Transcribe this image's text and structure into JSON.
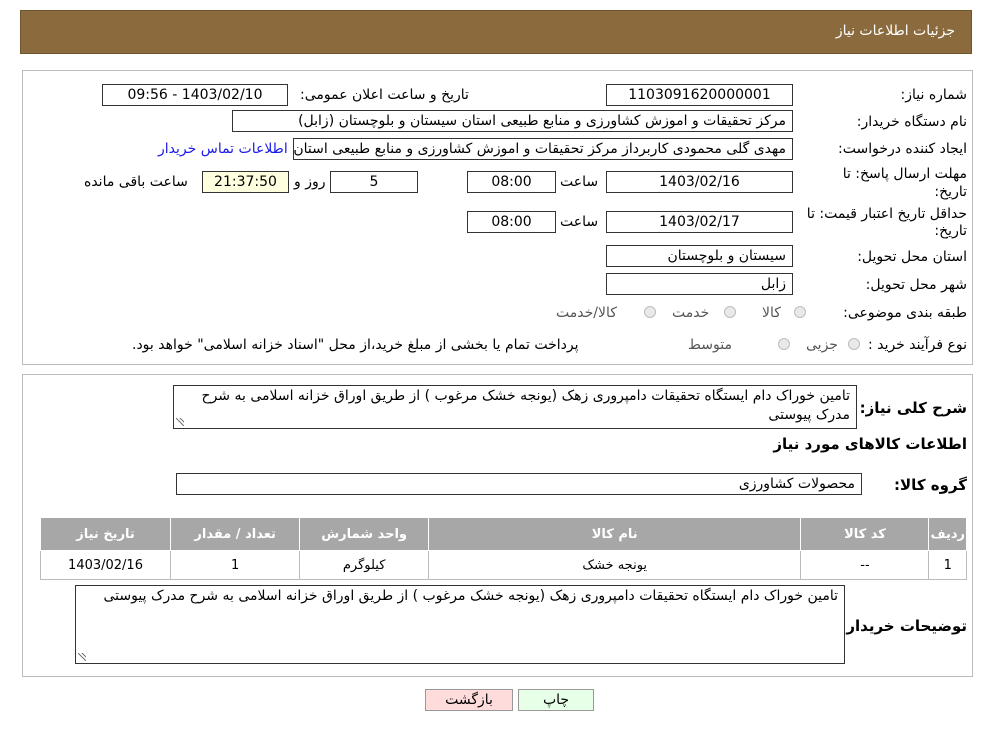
{
  "header": {
    "title": "جزئیات اطلاعات نیاز"
  },
  "form": {
    "need_number_label": "شماره نیاز:",
    "need_number": "1103091620000001",
    "announce_label": "تاریخ و ساعت اعلان عمومی:",
    "announce_value": "1403/02/10 - 09:56",
    "buyer_label": "نام دستگاه خریدار:",
    "buyer_value": "مرکز تحقیقات و اموزش کشاورزی و منابع طبیعی استان سیستان و بلوچستان (زابل)",
    "creator_label": "ایجاد کننده درخواست:",
    "creator_value": "مهدی  گلی محمودی کاربرداز مرکز تحقیقات و اموزش کشاورزی و منابع طبیعی استان",
    "contact_link": "اطلاعات تماس خریدار",
    "reply_deadline_label_1": "مهلت ارسال پاسخ: تا",
    "reply_deadline_label_2": "تاریخ:",
    "reply_date": "1403/02/16",
    "time_label": "ساعت",
    "reply_time": "08:00",
    "days_value": "5",
    "days_label": "روز و",
    "remaining_time": "21:37:50",
    "remaining_label": "ساعت باقی مانده",
    "validity_label_1": "حداقل تاریخ اعتبار قیمت: تا",
    "validity_label_2": "تاریخ:",
    "validity_date": "1403/02/17",
    "validity_time": "08:00",
    "province_label": "استان محل تحویل:",
    "province_value": "سیستان و بلوچستان",
    "city_label": "شهر محل تحویل:",
    "city_value": "زابل",
    "category_label": "طبقه بندی موضوعی:",
    "category_options": [
      "کالا",
      "خدمت",
      "کالا/خدمت"
    ],
    "process_label": "نوع فرآیند خرید :",
    "process_options": [
      "جزیی",
      "متوسط"
    ],
    "process_note": "پرداخت تمام یا بخشی از مبلغ خرید،از محل \"اسناد خزانه اسلامی\" خواهد بود."
  },
  "details": {
    "summary_label": "شرح کلی نیاز:",
    "summary_value": "تامین خوراک دام ایستگاه تحقیقات دامپروری زهک (یونجه خشک مرغوب ) از طریق اوراق خزانه اسلامی به شرح مدرک پیوستی",
    "goods_section_title": "اطلاعات کالاهای مورد نیاز",
    "goods_group_label": "گروه کالا:",
    "goods_group_value": "محصولات کشاورزی",
    "table": {
      "headers": [
        "ردیف",
        "کد کالا",
        "نام کالا",
        "واحد شمارش",
        "تعداد / مقدار",
        "تاریخ نیاز"
      ],
      "rows": [
        [
          "1",
          "--",
          "یونجه خشک",
          "کیلوگرم",
          "1",
          "1403/02/16"
        ]
      ]
    },
    "buyer_notes_label": "توضیحات خریدار:",
    "buyer_notes_value": "تامین خوراک دام ایستگاه تحقیقات دامپروری زهک (یونجه خشک مرغوب ) از طریق اوراق خزانه اسلامی به شرح مدرک پیوستی"
  },
  "buttons": {
    "print": "چاپ",
    "back": "بازگشت"
  },
  "colors": {
    "header_bg": "#8b6b3e",
    "table_header_bg": "#a7a7a7",
    "time_box_bg": "#ffffe0",
    "back_button_bg": "#ffdcdc",
    "print_button_bg": "#e6ffe6",
    "link": "#1a1ae6"
  }
}
